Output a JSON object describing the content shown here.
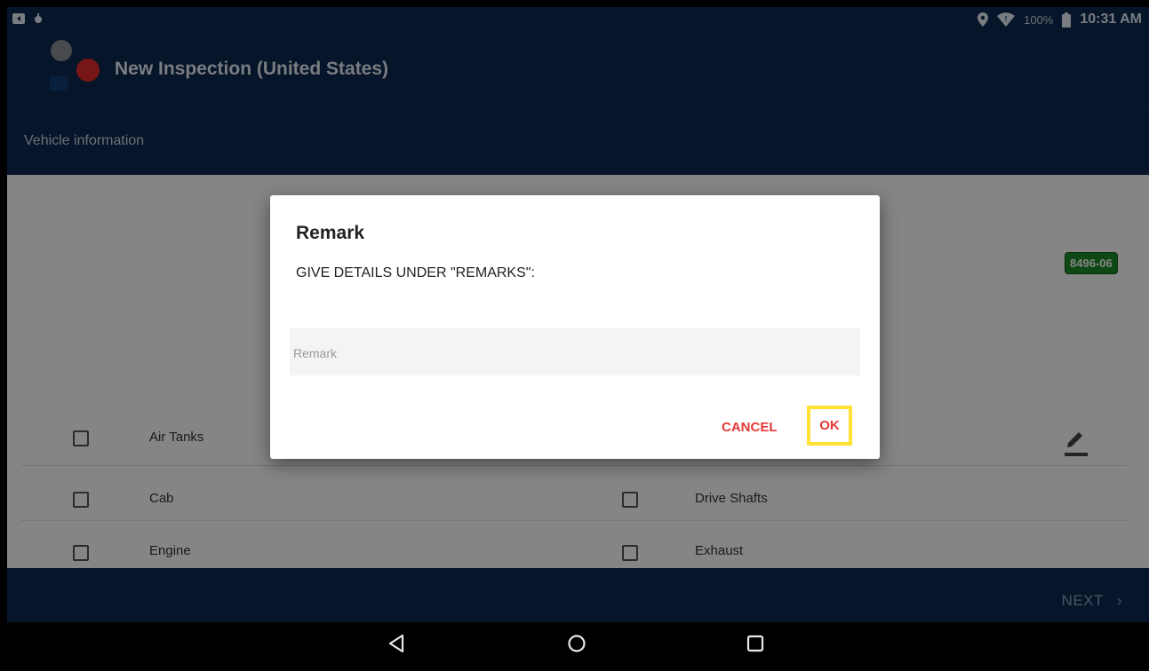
{
  "status_bar": {
    "battery": "100%",
    "time": "10:31 AM",
    "icons": [
      "screen-icon",
      "notification-icon",
      "location-icon",
      "wifi-icon",
      "battery-icon"
    ]
  },
  "app_bar": {
    "title": "New Inspection (United States)"
  },
  "section": {
    "title": "Vehicle information"
  },
  "vehicle": {
    "badge": "8496-06"
  },
  "checklist": {
    "left": [
      "Air Tanks",
      "Cab",
      "Engine"
    ],
    "right": [
      "Drive Shafts",
      "Exhaust"
    ]
  },
  "footer": {
    "next_label": "NEXT"
  },
  "dialog": {
    "title": "Remark",
    "message": "GIVE DETAILS UNDER \"REMARKS\":",
    "input_placeholder": "Remark",
    "input_value": "",
    "cancel_label": "CANCEL",
    "ok_label": "OK"
  },
  "colors": {
    "app_bar": "#0d2a4f",
    "accent_button": "#e53935",
    "highlight": "#ffe236",
    "badge": "#1b8a2a"
  }
}
